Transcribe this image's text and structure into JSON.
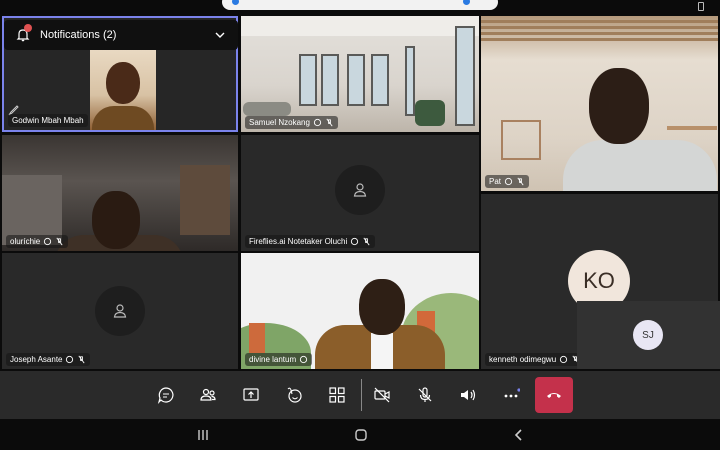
{
  "notifications": {
    "label": "Notifications (2)"
  },
  "participants": {
    "godwin": "Godwin Mbah Mbah",
    "samuel": "Samuel Nzokang",
    "pat": "Pat",
    "oluri": "oluríchie",
    "fireflies": "Fireflies.ai Notetaker Oluchi",
    "joseph": "Joseph Asante",
    "divine": "divine lantum",
    "kenneth": "kenneth odimegwu"
  },
  "avatars": {
    "kenneth_initials": "KO",
    "self_initials": "SJ"
  },
  "colors": {
    "active_border": "#7b83eb",
    "end_call": "#c4314b",
    "tile": "#2a2a2a",
    "toolbar": "#2a2a2a"
  },
  "icons": {
    "toolbar": [
      "chat-icon",
      "people-icon",
      "share-screen-icon",
      "reactions-icon",
      "view-grid-icon",
      "camera-off-icon",
      "mic-off-icon",
      "speaker-icon",
      "more-icon",
      "hang-up-icon"
    ],
    "nav": [
      "recent-apps-icon",
      "home-icon",
      "back-icon"
    ]
  }
}
